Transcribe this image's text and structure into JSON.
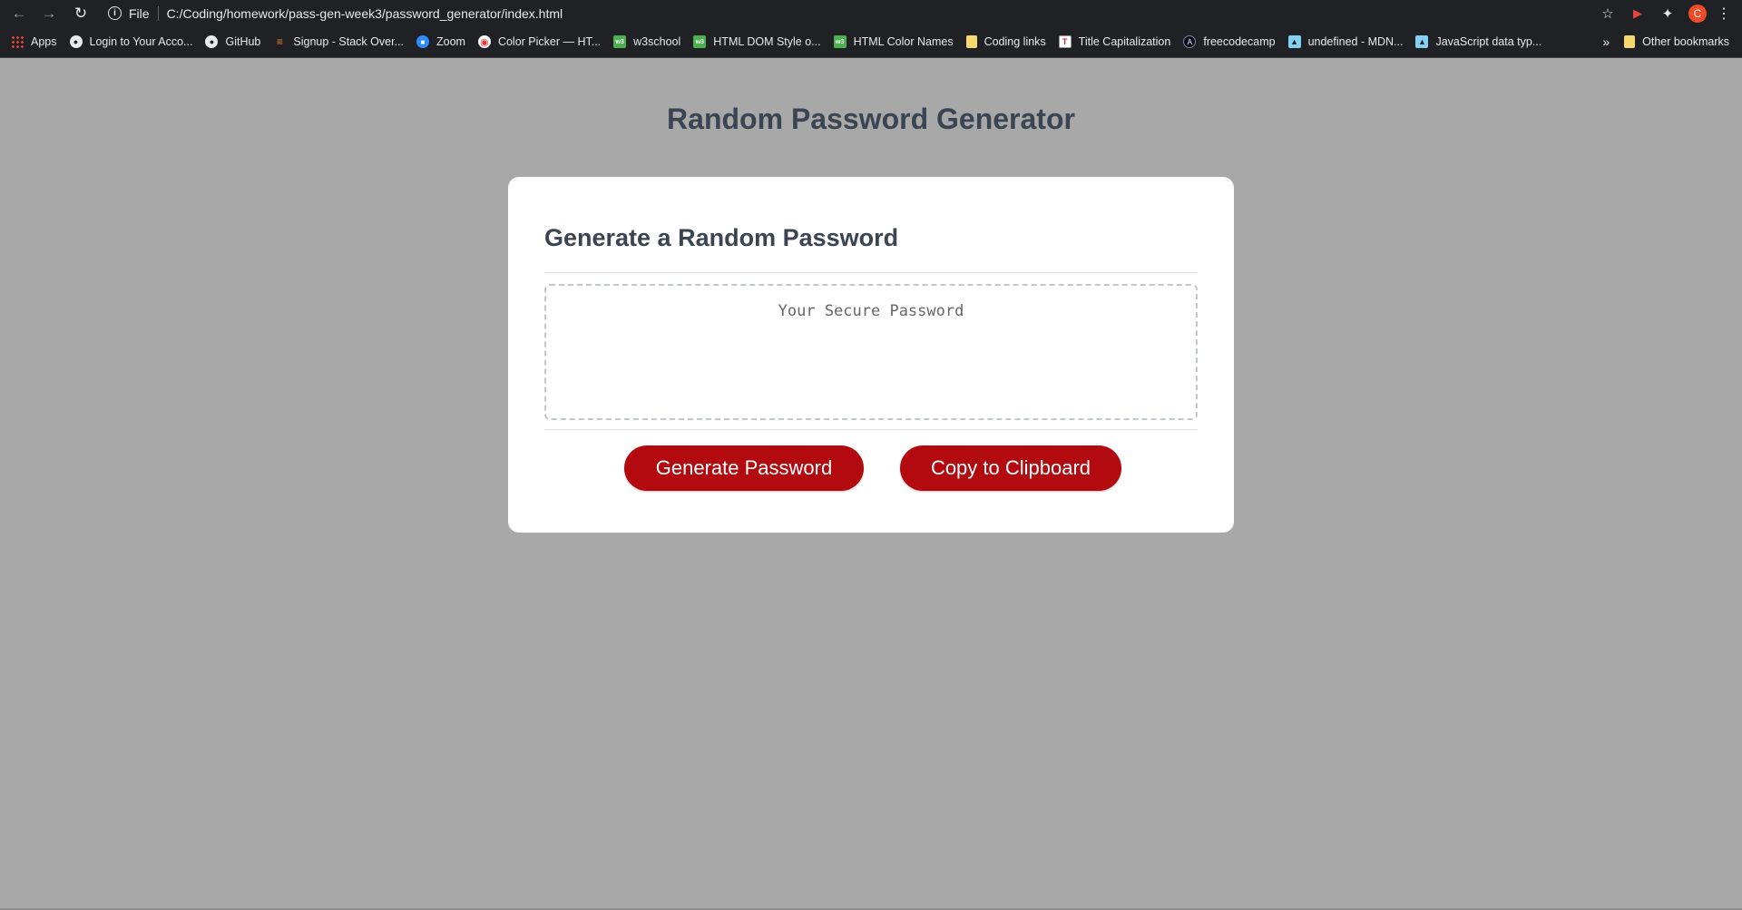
{
  "browser": {
    "scheme_label": "File",
    "url": "C:/Coding/homework/pass-gen-week3/password_generator/index.html",
    "bookmarks": [
      {
        "label": "Apps",
        "icon": "apps-grid-icon"
      },
      {
        "label": "Login to Your Acco...",
        "icon": "globe-icon"
      },
      {
        "label": "GitHub",
        "icon": "github-icon"
      },
      {
        "label": "Signup - Stack Over...",
        "icon": "stackoverflow-icon"
      },
      {
        "label": "Zoom",
        "icon": "zoom-icon"
      },
      {
        "label": "Color Picker — HT...",
        "icon": "color-picker-icon"
      },
      {
        "label": "w3school",
        "icon": "w3schools-icon"
      },
      {
        "label": "HTML DOM Style o...",
        "icon": "w3schools-icon"
      },
      {
        "label": "HTML Color Names",
        "icon": "w3schools-icon"
      },
      {
        "label": "Coding links",
        "icon": "folder-icon"
      },
      {
        "label": "Title Capitalization",
        "icon": "title-cap-icon"
      },
      {
        "label": "freecodecamp",
        "icon": "freecodecamp-icon"
      },
      {
        "label": "undefined - MDN...",
        "icon": "mdn-icon"
      },
      {
        "label": "JavaScript data typ...",
        "icon": "mdn-icon"
      }
    ],
    "more_label": "»",
    "other_bookmarks_label": "Other bookmarks",
    "avatar_letter": "C"
  },
  "page": {
    "title": "Random Password Generator",
    "card_header": "Generate a Random Password",
    "password_placeholder": "Your Secure Password",
    "generate_label": "Generate Password",
    "copy_label": "Copy to Clipboard"
  },
  "colors": {
    "page_background": "#a8a8a8",
    "button": "#b20a0f",
    "heading": "#3b4452"
  }
}
